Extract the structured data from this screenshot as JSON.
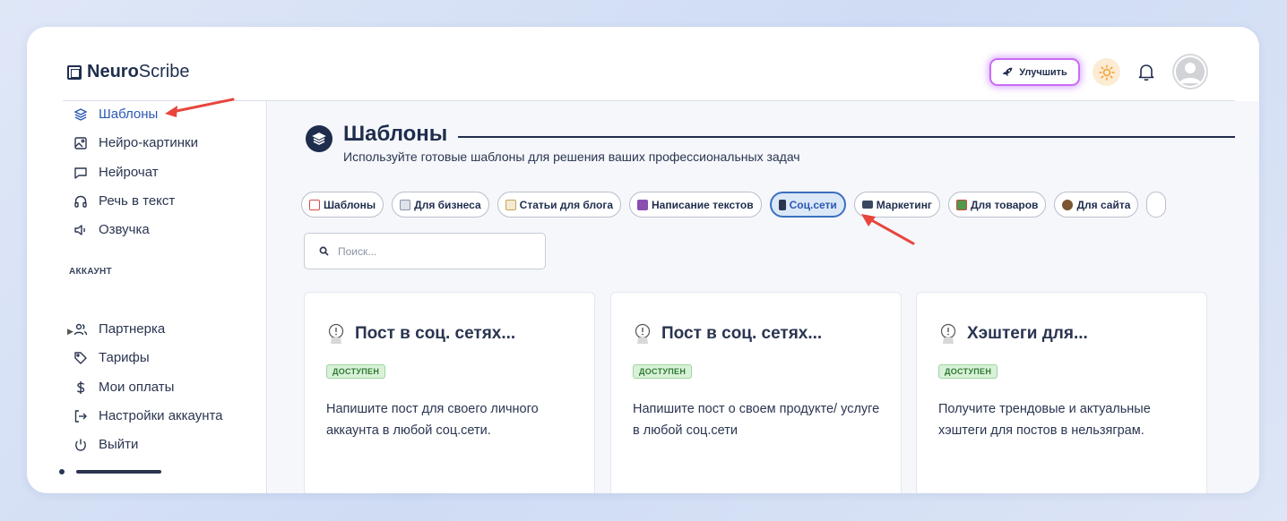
{
  "app": {
    "logo_bold": "Neuro",
    "logo_rest": "Scribe"
  },
  "header": {
    "upgrade_label": "Улучшить",
    "icons": [
      "rocket-icon",
      "sun-icon",
      "bell-icon",
      "avatar"
    ]
  },
  "sidebar": {
    "items": [
      {
        "label": "Шаблоны",
        "icon": "layers-icon",
        "active": true
      },
      {
        "label": "Нейро-картинки",
        "icon": "image-icon"
      },
      {
        "label": "Нейрочат",
        "icon": "chat-icon"
      },
      {
        "label": "Речь в текст",
        "icon": "headphones-icon"
      },
      {
        "label": "Озвучка",
        "icon": "speaker-icon"
      }
    ],
    "account_title": "АККАУНТ",
    "account_items": [
      {
        "label": "Партнерка",
        "icon": "users-icon"
      },
      {
        "label": "Тарифы",
        "icon": "tag-icon"
      },
      {
        "label": "Мои оплаты",
        "icon": "dollar-icon"
      },
      {
        "label": "Настройки аккаунта",
        "icon": "login-icon"
      },
      {
        "label": "Выйти",
        "icon": "power-icon"
      }
    ]
  },
  "main": {
    "title": "Шаблоны",
    "subtitle": "Используйте готовые шаблоны для решения ваших профессиональных задач",
    "chips": [
      {
        "label": "Шаблоны",
        "color": "#d94c4c"
      },
      {
        "label": "Для бизнеса",
        "color": "#8a93a6"
      },
      {
        "label": "Статьи для блога",
        "color": "#c9a35a"
      },
      {
        "label": "Написание текстов",
        "color": "#8a4fb0"
      },
      {
        "label": "Соц.сети",
        "color": "#2a3550",
        "active": true
      },
      {
        "label": "Маркетинг",
        "color": "#3a4560"
      },
      {
        "label": "Для товаров",
        "color": "#4f9a4a"
      },
      {
        "label": "Для сайта",
        "color": "#7a5530"
      }
    ],
    "search_placeholder": "Поиск...",
    "cards": [
      {
        "title": "Пост в соц. сетях...",
        "badge": "ДОСТУПЕН",
        "text": "Напишите пост для своего личного аккаунта в любой соц.сети."
      },
      {
        "title": "Пост в соц. сетях...",
        "badge": "ДОСТУПЕН",
        "text": "Напишите пост о своем продукте/ услуге в любой соц.сети"
      },
      {
        "title": "Хэштеги для...",
        "badge": "ДОСТУПЕН",
        "text": "Получите трендовые и актуальные хэштеги для постов в нельзяграм."
      }
    ]
  },
  "colors": {
    "accent": "#2b58b5",
    "arrow": "#e8453c",
    "badge_green": "#2f7a32"
  }
}
